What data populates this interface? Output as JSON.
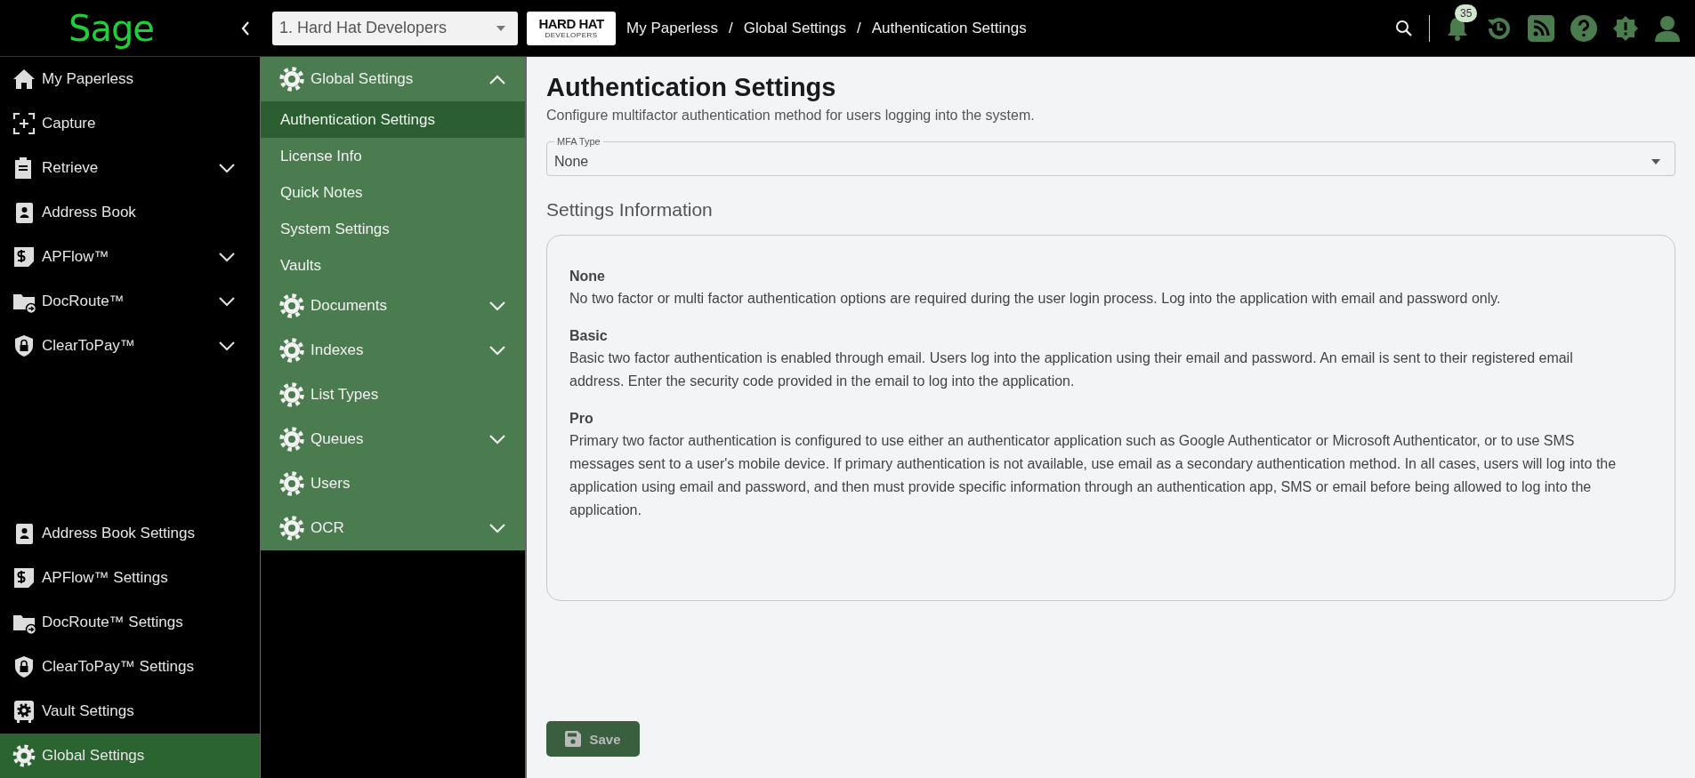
{
  "top_bar": {
    "logo": "Sage",
    "vault_select": {
      "value": "1. Hard Hat Developers"
    },
    "company_logo": {
      "line_1": "HARD HAT",
      "line_2": "DEVELOPERS"
    },
    "breadcrumbs": [
      {
        "label": "My Paperless"
      },
      {
        "separator": "/",
        "label": "Global Settings"
      },
      {
        "separator": "/",
        "label": "Authentication Settings"
      }
    ],
    "notifications_count": "35"
  },
  "sidebar": {
    "items": [
      {
        "label": "My Paperless",
        "selected": false
      },
      {
        "label": "Capture",
        "selected": false
      },
      {
        "label": "Retrieve",
        "selected": false,
        "expanded": false
      },
      {
        "label": "Address Book",
        "selected": false
      },
      {
        "label": "APFlow™",
        "selected": false,
        "expanded": false
      },
      {
        "label": "DocRoute™",
        "selected": false,
        "expanded": false
      },
      {
        "label": "ClearToPay™",
        "selected": false,
        "expanded": false
      }
    ],
    "settings_items": [
      {
        "label": "Address Book Settings",
        "selected": false
      },
      {
        "label": "APFlow™ Settings",
        "selected": false
      },
      {
        "label": "DocRoute™ Settings",
        "selected": false
      },
      {
        "label": "ClearToPay™ Settings",
        "selected": false
      },
      {
        "label": "Vault Settings",
        "selected": false
      },
      {
        "label": "Global Settings",
        "selected": true
      }
    ]
  },
  "settings_menu": [
    {
      "label": "Global Settings",
      "expanded": true,
      "children": [
        {
          "label": "Authentication Settings",
          "selected": true
        },
        {
          "label": "License Info",
          "selected": false
        },
        {
          "label": "Quick Notes",
          "selected": false
        },
        {
          "label": "System Settings",
          "selected": false
        },
        {
          "label": "Vaults",
          "selected": false
        }
      ]
    },
    {
      "label": "Documents",
      "expanded": false
    },
    {
      "label": "Indexes",
      "expanded": false
    },
    {
      "label": "List Types"
    },
    {
      "label": "Queues",
      "expanded": false
    },
    {
      "label": "Users"
    },
    {
      "label": "OCR",
      "expanded": false
    }
  ],
  "main": {
    "title": "Authentication Settings",
    "description": "Configure multifactor authentication method for users logging into the system.",
    "mfa_type": {
      "label": "MFA Type",
      "value": "None"
    },
    "info_heading": "Settings Information",
    "info": [
      {
        "heading": "None",
        "text": "No two factor or multi factor authentication options are required during the user login process. Log into the application with email and password only."
      },
      {
        "heading": "Basic",
        "text": "Basic two factor authentication is enabled through email. Users log into the application using their email and password. An email is sent to their registered email address. Enter the security code provided in the email to log into the application."
      },
      {
        "heading": "Pro",
        "text": "Primary two factor authentication is configured to use either an authenticator application such as Google Authenticator or Microsoft Authenticator, or to use SMS messages sent to a user's mobile device. If primary authentication is not available, use email as a secondary authentication method. In all cases, users will log into the application using email and password, and then must provide specific information through an authentication app, SMS or email before being allowed to log into the application."
      }
    ],
    "save_button": "Save"
  }
}
